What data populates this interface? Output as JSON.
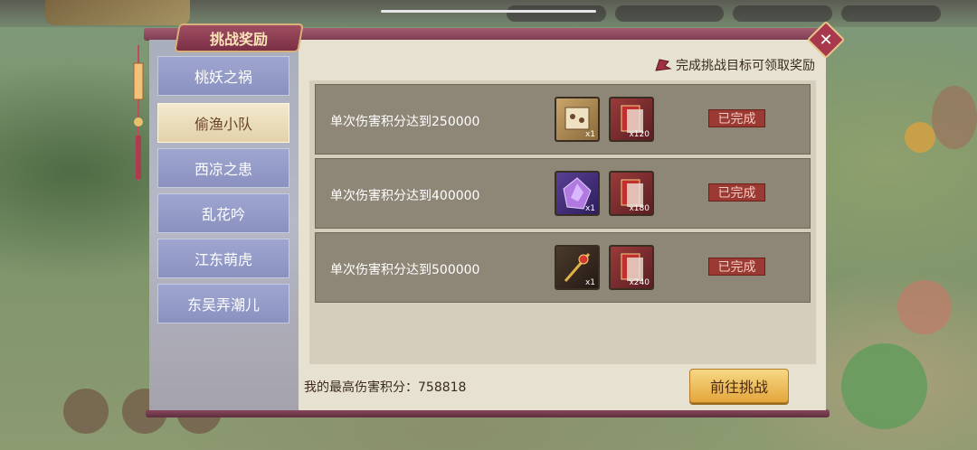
{
  "panel": {
    "title": "挑战奖励",
    "close_icon": "close-icon",
    "hint": "完成挑战目标可领取奖励"
  },
  "sidebar": {
    "items": [
      {
        "label": "桃妖之祸",
        "active": false
      },
      {
        "label": "偷渔小队",
        "active": true
      },
      {
        "label": "西凉之患",
        "active": false
      },
      {
        "label": "乱花吟",
        "active": false
      },
      {
        "label": "江东萌虎",
        "active": false
      },
      {
        "label": "东吴弄潮儿",
        "active": false
      }
    ]
  },
  "rewards": [
    {
      "goal": "单次伤害积分达到250000",
      "items": [
        {
          "icon": "scroll-icon",
          "qty": "x1"
        },
        {
          "icon": "red-envelope-icon",
          "qty": "x120"
        }
      ],
      "status": "已完成"
    },
    {
      "goal": "单次伤害积分达到400000",
      "items": [
        {
          "icon": "purple-gem-icon",
          "qty": "x1"
        },
        {
          "icon": "red-envelope-icon",
          "qty": "x180"
        }
      ],
      "status": "已完成"
    },
    {
      "goal": "单次伤害积分达到500000",
      "items": [
        {
          "icon": "golden-staff-icon",
          "qty": "x1"
        },
        {
          "icon": "red-envelope-icon",
          "qty": "x240"
        }
      ],
      "status": "已完成"
    }
  ],
  "footer": {
    "score_label": "我的最高伤害积分：",
    "score_value": "758818",
    "go_button": "前往挑战"
  },
  "colors": {
    "accent": "#a04e62",
    "done_badge": "#9a3a32",
    "button": "#e4a63c"
  }
}
